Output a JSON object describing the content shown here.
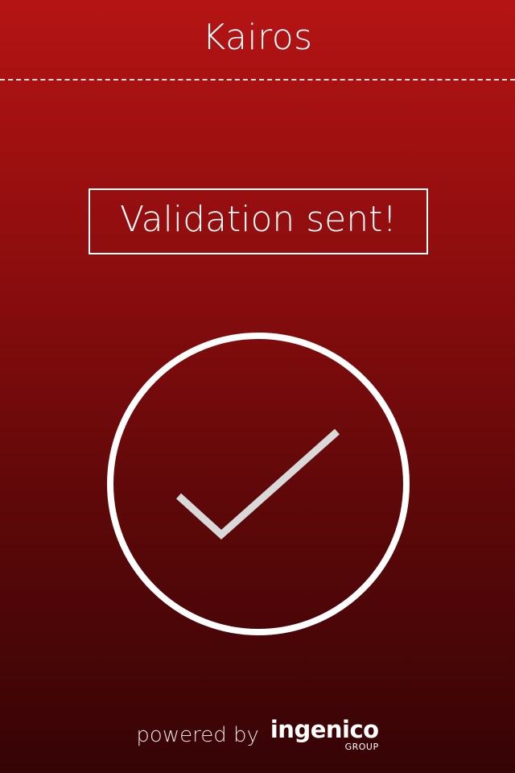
{
  "header": {
    "title": "Kairos"
  },
  "status": {
    "message": "Validation sent!",
    "icon": "check-circle-icon"
  },
  "footer": {
    "powered_by": "powered by",
    "brand_name": "ingenico",
    "brand_group": "GROUP"
  },
  "colors": {
    "background_top": "#b51414",
    "background_bottom": "#360405",
    "foreground": "#ffffff",
    "checkmark": "#d9d9d9"
  }
}
